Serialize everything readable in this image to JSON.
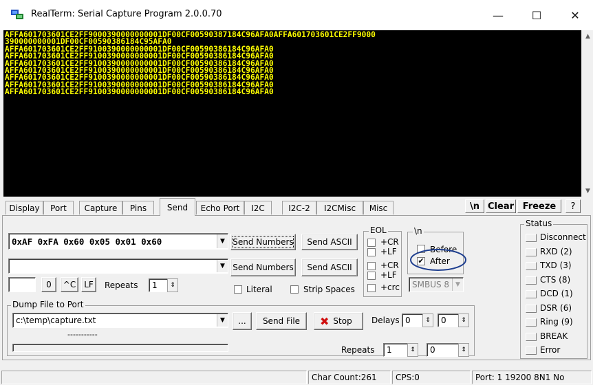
{
  "window": {
    "title": "RealTerm: Serial Capture Program 2.0.0.70",
    "minimize": "—",
    "maximize": "☐",
    "close": "✕"
  },
  "terminal": {
    "lines": [
      "AFFA601703601CE2FF9000390000000001DF00CF00590387184C96AFA0AFFA601703601CE2FF9000",
      "390000000001DF00CF00590386184C95AFA0",
      "AFFA601703601CE2FF9100390000000001DF00CF00590386184C96AFA0",
      "AFFA601703601CE2FF9100390000000001DF00CF00590386184C96AFA0",
      "AFFA601703601CE2FF9100390000000001DF00CF00590386184C96AFA0",
      "AFFA601703601CE2FF9100390000000001DF00CF00590386184C96AFA0",
      "AFFA601703601CE2FF9100390000000001DF00CF00590386184C96AFA0",
      "AFFA601703601CE2FF9100390000000001DF00CF00590386184C96AFA0",
      "AFFA601703601CE2FF9100390000000001DF00CF00590386184C96AFA0"
    ]
  },
  "tabs": [
    "Display",
    "Port",
    "Capture",
    "Pins",
    "Send",
    "Echo Port",
    "I2C",
    "I2C-2",
    "I2CMisc",
    "Misc"
  ],
  "active_tab": "Send",
  "toolbar": {
    "newline": "\\n",
    "clear": "Clear",
    "freeze": "Freeze",
    "help": "?"
  },
  "send": {
    "numbers_value": "0xAF 0xFA 0x60 0x05 0x01 0x60",
    "send_numbers_1": "Send Numbers",
    "send_ascii_1": "Send ASCII",
    "numbers_value_2": "",
    "send_numbers_2": "Send Numbers",
    "send_ascii_2": "Send ASCII",
    "char_value": "",
    "zero_btn": "0",
    "ctrlc_btn": "^C",
    "lf_btn": "LF",
    "repeats_label": "Repeats",
    "repeats_value": "1",
    "literal_label": "Literal",
    "strip_spaces_label": "Strip Spaces",
    "eol_title": "EOL",
    "eol": [
      "+CR",
      "+LF",
      "+CR",
      "+LF",
      "+crc"
    ],
    "nl_title": "\\n",
    "before_label": "Before",
    "after_label": "After",
    "after_checked": "✔",
    "smbus_value": "SMBUS 8"
  },
  "dump": {
    "title": "Dump File to Port",
    "file_value": "c:\\temp\\capture.txt",
    "browse": "...",
    "send_file": "Send File",
    "stop": "Stop",
    "delays_label": "Delays",
    "delay1": "0",
    "delay2": "0",
    "progress_text": "-----------",
    "repeats_label": "Repeats",
    "repeats1": "1",
    "repeats2": "0"
  },
  "status": {
    "title": "Status",
    "items": [
      "Disconnect",
      "RXD (2)",
      "TXD (3)",
      "CTS (8)",
      "DCD (1)",
      "DSR (6)",
      "Ring (9)",
      "BREAK",
      "Error"
    ]
  },
  "statusbar": {
    "char_count": "Char Count:261",
    "cps": "CPS:0",
    "port": "Port: 1 19200 8N1 No"
  },
  "colors": {
    "terminal_bg": "#000000",
    "terminal_fg": "#ffff00",
    "highlight_circle": "#1f3f8f",
    "stop_icon": "#d01010"
  }
}
